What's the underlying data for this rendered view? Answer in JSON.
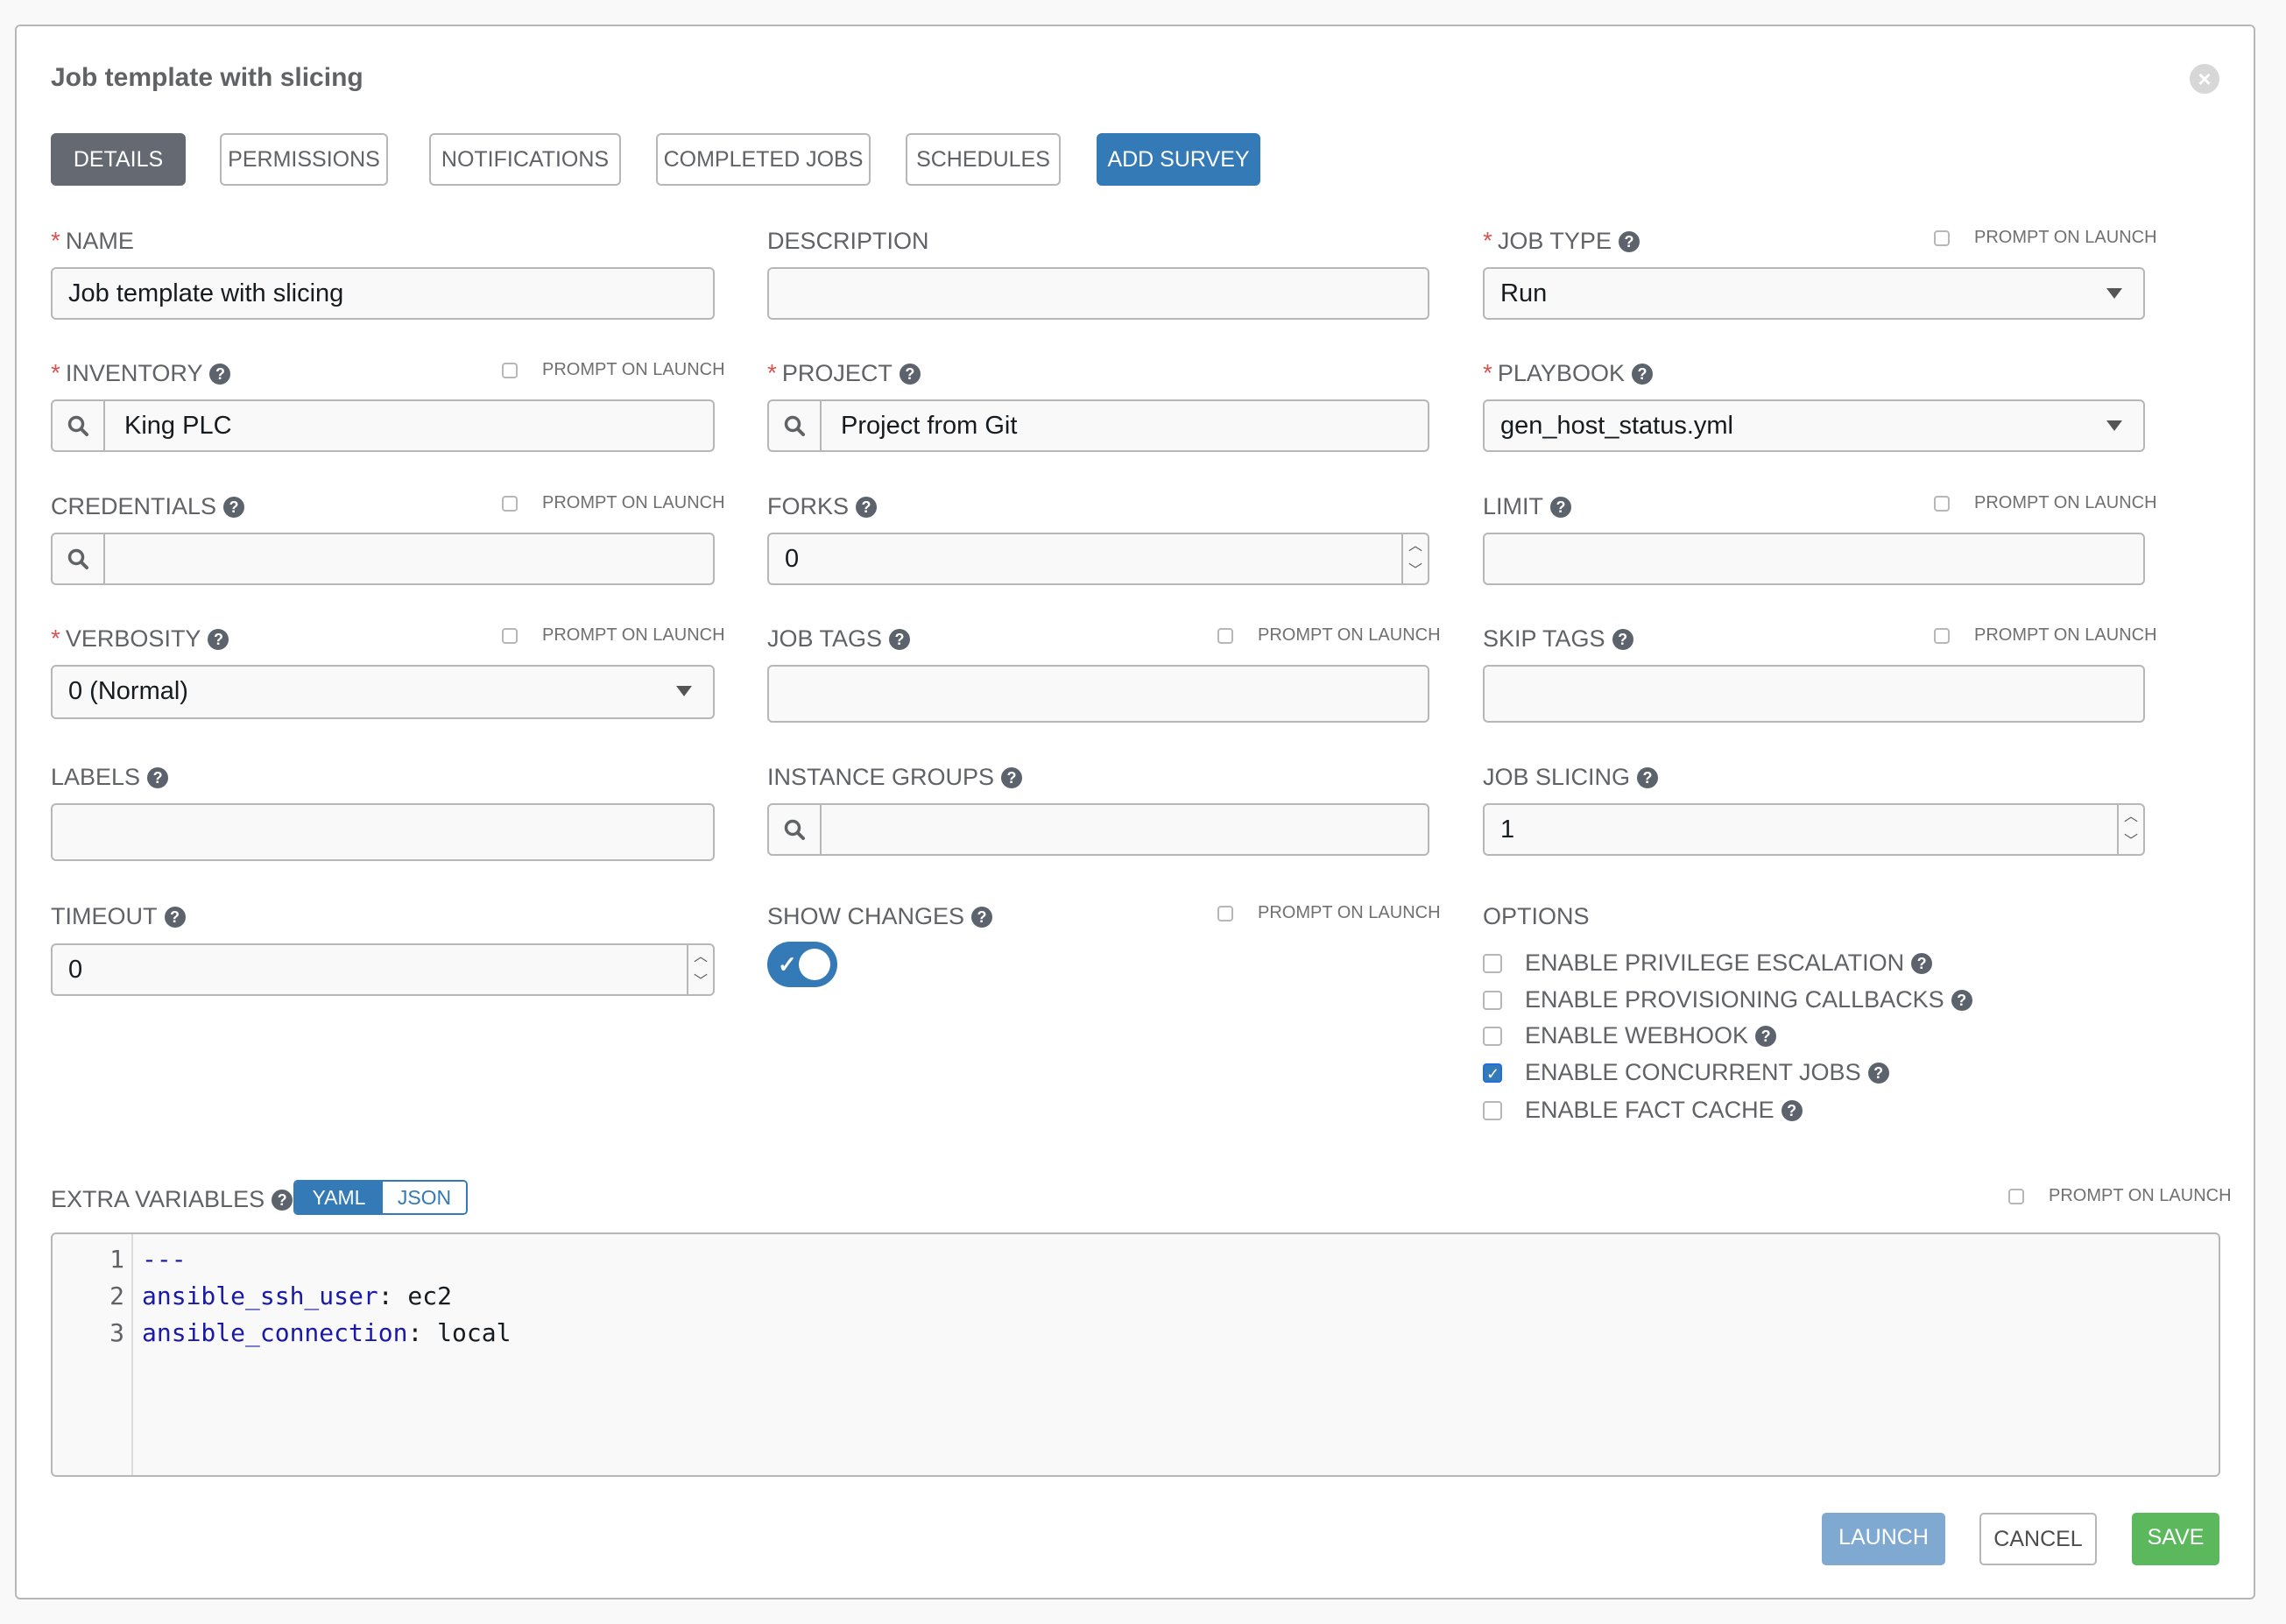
{
  "page": {
    "title": "Job template with slicing"
  },
  "tabs": [
    {
      "label": "DETAILS",
      "state": "active"
    },
    {
      "label": "PERMISSIONS"
    },
    {
      "label": "NOTIFICATIONS"
    },
    {
      "label": "COMPLETED JOBS"
    },
    {
      "label": "SCHEDULES"
    },
    {
      "label": "ADD SURVEY",
      "state": "primary"
    }
  ],
  "prompt_on_launch": "PROMPT ON LAUNCH",
  "fields": {
    "name": {
      "label": "NAME",
      "value": "Job template with slicing",
      "required": true
    },
    "description": {
      "label": "DESCRIPTION",
      "value": ""
    },
    "job_type": {
      "label": "JOB TYPE",
      "value": "Run",
      "required": true
    },
    "inventory": {
      "label": "INVENTORY",
      "value": "King PLC",
      "required": true
    },
    "project": {
      "label": "PROJECT",
      "value": "Project from Git",
      "required": true
    },
    "playbook": {
      "label": "PLAYBOOK",
      "value": "gen_host_status.yml",
      "required": true
    },
    "credentials": {
      "label": "CREDENTIALS",
      "value": ""
    },
    "forks": {
      "label": "FORKS",
      "value": "0"
    },
    "limit": {
      "label": "LIMIT",
      "value": ""
    },
    "verbosity": {
      "label": "VERBOSITY",
      "value": "0 (Normal)",
      "required": true
    },
    "job_tags": {
      "label": "JOB TAGS",
      "value": ""
    },
    "skip_tags": {
      "label": "SKIP TAGS",
      "value": ""
    },
    "labels": {
      "label": "LABELS",
      "value": ""
    },
    "instance_groups": {
      "label": "INSTANCE GROUPS",
      "value": ""
    },
    "job_slicing": {
      "label": "JOB SLICING",
      "value": "1"
    },
    "timeout": {
      "label": "TIMEOUT",
      "value": "0"
    },
    "show_changes": {
      "label": "SHOW CHANGES",
      "enabled": true
    }
  },
  "options": {
    "label": "OPTIONS",
    "items": [
      {
        "label": "ENABLE PRIVILEGE ESCALATION",
        "checked": false
      },
      {
        "label": "ENABLE PROVISIONING CALLBACKS",
        "checked": false
      },
      {
        "label": "ENABLE WEBHOOK",
        "checked": false
      },
      {
        "label": "ENABLE CONCURRENT JOBS",
        "checked": true
      },
      {
        "label": "ENABLE FACT CACHE",
        "checked": false
      }
    ]
  },
  "extra_variables": {
    "label": "EXTRA VARIABLES",
    "formats": [
      "YAML",
      "JSON"
    ],
    "selected_format": "YAML",
    "lines": [
      {
        "num": "1",
        "key": "---",
        "value": ""
      },
      {
        "num": "2",
        "key": "ansible_ssh_user",
        "sep": ":",
        "value": " ec2"
      },
      {
        "num": "3",
        "key": "ansible_connection",
        "sep": ":",
        "value": " local"
      }
    ]
  },
  "actions": {
    "launch": "LAUNCH",
    "cancel": "CANCEL",
    "save": "SAVE"
  },
  "colors": {
    "primary": "#337ab7",
    "launch": "#7fa9d1",
    "save": "#5cb85c",
    "active_tab": "#646972",
    "required": "#d9534f"
  }
}
